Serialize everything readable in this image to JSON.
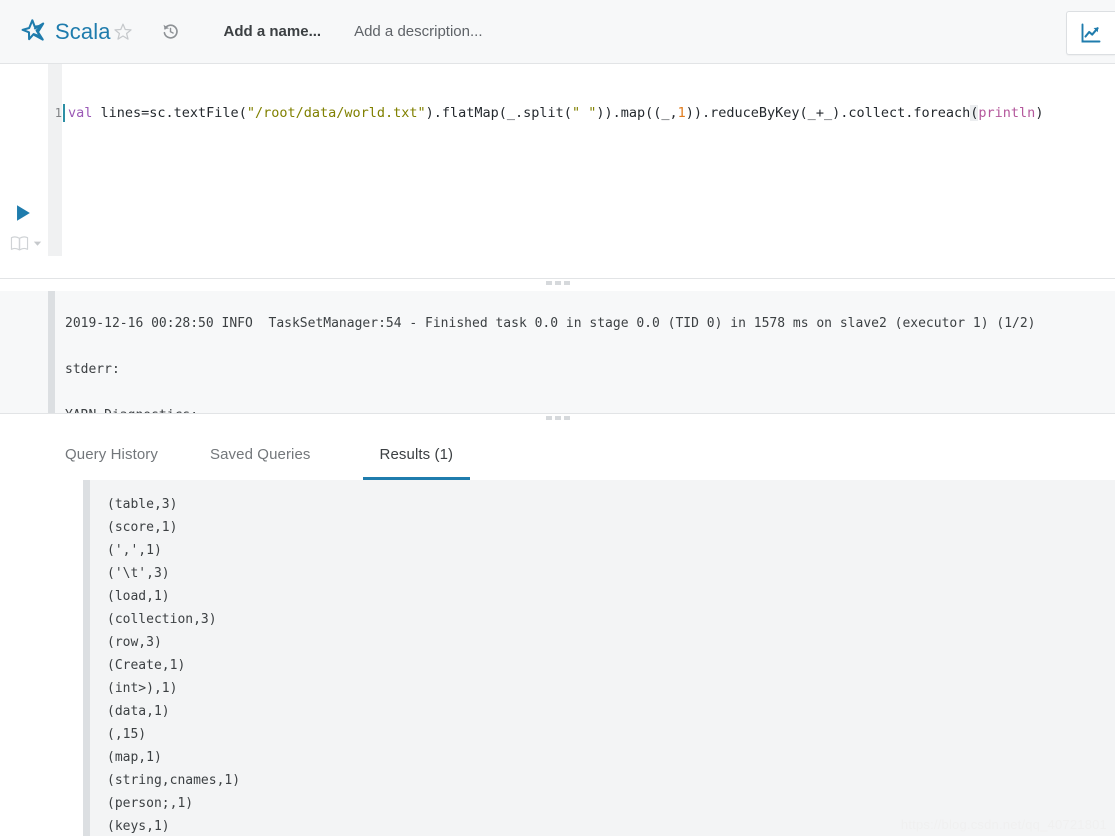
{
  "header": {
    "brand_name": "Scala",
    "logo_icon": "scala-star-logo",
    "favorite_icon": "star-outline-icon",
    "history_icon": "history-revert-icon",
    "name_placeholder": "Add a name...",
    "description_placeholder": "Add a description...",
    "chart_button_icon": "line-chart-icon"
  },
  "editor": {
    "run_icon": "play-run-icon",
    "book_icon": "book-open-icon",
    "caret_icon": "chevron-down-icon",
    "line_number": "1",
    "code_tokens": [
      {
        "t": "val",
        "c": "kw"
      },
      {
        "t": " lines=sc.textFile(",
        "c": ""
      },
      {
        "t": "\"/root/data/world.txt\"",
        "c": "str"
      },
      {
        "t": ").flatMap(_.split(",
        "c": ""
      },
      {
        "t": "\" \"",
        "c": "str"
      },
      {
        "t": ")).map((_,",
        "c": ""
      },
      {
        "t": "1",
        "c": "num"
      },
      {
        "t": ")).reduceByKey(_",
        "c": ""
      },
      {
        "t": "+",
        "c": ""
      },
      {
        "t": "_).collect.foreach",
        "c": ""
      },
      {
        "t": "(",
        "c": "op-hl"
      },
      {
        "t": "println",
        "c": "fn"
      },
      {
        "t": ")",
        "c": ""
      }
    ],
    "code_plain": "val lines=sc.textFile(\"/root/data/world.txt\").flatMap(_.split(\" \")).map((_,1)).reduceByKey(_+_).collect.foreach(println)"
  },
  "log": {
    "lines": [
      "2019-12-16 00:28:50 INFO  TaskSetManager:54 - Finished task 0.0 in stage 0.0 (TID 0) in 1578 ms on slave2 (executor 1) (1/2)",
      "stderr:",
      "YARN Diagnostics:"
    ]
  },
  "tabs": [
    {
      "label": "Query History",
      "active": false
    },
    {
      "label": "Saved Queries",
      "active": false
    },
    {
      "label": "Results (1)",
      "active": true
    }
  ],
  "results": {
    "rows": [
      "(table,3)",
      "(score,1)",
      "(',',1)",
      "('\\t',3)",
      "(load,1)",
      "(collection,3)",
      "(row,3)",
      "(Create,1)",
      "(int>),1)",
      "(data,1)",
      "(,15)",
      "(map,1)",
      "(string,cnames,1)",
      "(person;,1)",
      "(keys,1)"
    ]
  },
  "watermark": "https://blog.csdn.net/qq_40721801",
  "colors": {
    "brand_blue": "#1f7cad",
    "accent_blue": "#1f7cad",
    "header_bg": "#f7f8f9",
    "panel_bg": "#f3f4f5",
    "border": "#e2e4e6",
    "text": "#3c4043",
    "muted_text": "#73777b",
    "keyword": "#9b59b6",
    "string": "#808000",
    "number": "#e07b1c",
    "function": "#b4589c"
  }
}
